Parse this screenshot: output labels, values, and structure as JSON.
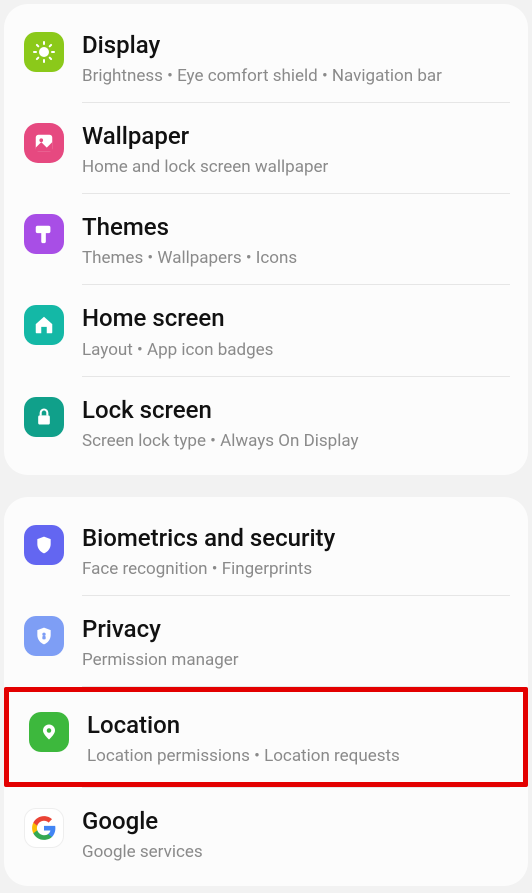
{
  "group1": {
    "display": {
      "title": "Display",
      "subtitle": "Brightness  •  Eye comfort shield  •  Navigation bar"
    },
    "wallpaper": {
      "title": "Wallpaper",
      "subtitle": "Home and lock screen wallpaper"
    },
    "themes": {
      "title": "Themes",
      "subtitle": "Themes  •  Wallpapers  •  Icons"
    },
    "home": {
      "title": "Home screen",
      "subtitle": "Layout  •  App icon badges"
    },
    "lock": {
      "title": "Lock screen",
      "subtitle": "Screen lock type  •  Always On Display"
    }
  },
  "group2": {
    "biometrics": {
      "title": "Biometrics and security",
      "subtitle": "Face recognition  •  Fingerprints"
    },
    "privacy": {
      "title": "Privacy",
      "subtitle": "Permission manager"
    },
    "location": {
      "title": "Location",
      "subtitle": "Location permissions  •  Location requests"
    },
    "google": {
      "title": "Google",
      "subtitle": "Google services"
    }
  }
}
